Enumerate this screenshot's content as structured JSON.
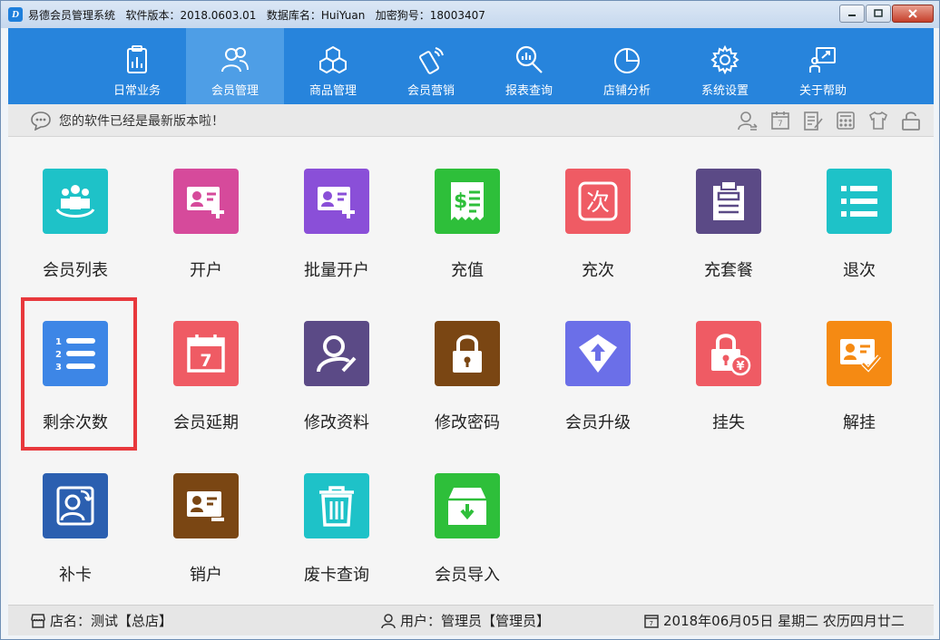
{
  "window": {
    "title": "易德会员管理系统   软件版本：2018.0603.01   数据库名：HuiYuan   加密狗号：18003407",
    "app_icon_letter": "D"
  },
  "nav": [
    {
      "label": "日常业务",
      "icon": "clipboard-chart-icon"
    },
    {
      "label": "会员管理",
      "icon": "members-icon",
      "active": true
    },
    {
      "label": "商品管理",
      "icon": "cubes-icon"
    },
    {
      "label": "会员营销",
      "icon": "phone-signal-icon"
    },
    {
      "label": "报表查询",
      "icon": "magnifier-chart-icon"
    },
    {
      "label": "店铺分析",
      "icon": "pie-chart-icon"
    },
    {
      "label": "系统设置",
      "icon": "gear-icon"
    },
    {
      "label": "关于帮助",
      "icon": "help-board-icon"
    }
  ],
  "notice": {
    "text": "您的软件已经是最新版本啦！"
  },
  "toolbar_icons": [
    "user-switch-icon",
    "calendar-icon",
    "notes-icon",
    "calculator-icon",
    "shirt-icon",
    "lock-icon"
  ],
  "tiles": [
    {
      "label": "会员列表",
      "color": "#1ec2c8",
      "icon": "member-group-icon"
    },
    {
      "label": "开户",
      "color": "#d64a9b",
      "icon": "card-add-icon"
    },
    {
      "label": "批量开户",
      "color": "#8a4fd8",
      "icon": "card-add-icon"
    },
    {
      "label": "充值",
      "color": "#2ebf3a",
      "icon": "receipt-dollar-icon"
    },
    {
      "label": "充次",
      "color": "#ef5b64",
      "icon": "count-char-icon",
      "char": "次"
    },
    {
      "label": "充套餐",
      "color": "#5b4a86",
      "icon": "clipboard-icon"
    },
    {
      "label": "退次",
      "color": "#1ec2c8",
      "icon": "list-icon"
    },
    {
      "label": "剩余次数",
      "color": "#3d86e6",
      "icon": "numbered-list-icon"
    },
    {
      "label": "会员延期",
      "color": "#ef5b64",
      "icon": "calendar-7-icon"
    },
    {
      "label": "修改资料",
      "color": "#5b4a86",
      "icon": "user-edit-icon"
    },
    {
      "label": "修改密码",
      "color": "#7a4613",
      "icon": "padlock-icon"
    },
    {
      "label": "会员升级",
      "color": "#6b6fe8",
      "icon": "upgrade-icon"
    },
    {
      "label": "挂失",
      "color": "#ef5b64",
      "icon": "lost-lock-icon"
    },
    {
      "label": "解挂",
      "color": "#f58a13",
      "icon": "card-check-icon"
    },
    {
      "label": "补卡",
      "color": "#2b5fb0",
      "icon": "reissue-card-icon"
    },
    {
      "label": "销户",
      "color": "#7a4613",
      "icon": "card-remove-icon"
    },
    {
      "label": "废卡查询",
      "color": "#1ec2c8",
      "icon": "trash-icon"
    },
    {
      "label": "会员导入",
      "color": "#2ebf3a",
      "icon": "import-box-icon"
    }
  ],
  "status": {
    "store": "店名：测试【总店】",
    "user": "用户：管理员【管理员】",
    "date": "2018年06月05日 星期二 农历四月廿二"
  }
}
